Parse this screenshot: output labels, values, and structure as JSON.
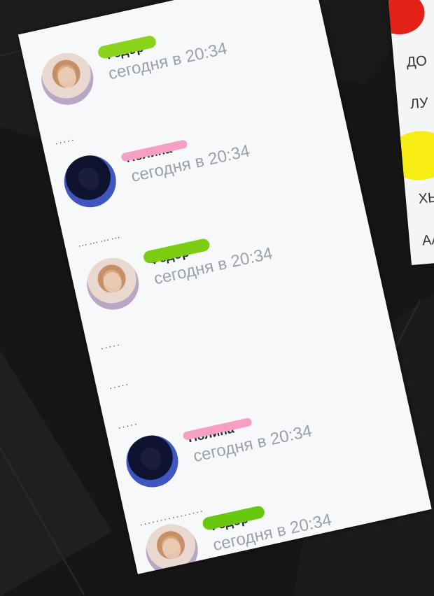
{
  "messages": [
    {
      "name": "Федор",
      "time": "сегодня в 20:34",
      "avatar": "anime",
      "blur_color": "#8bd31a",
      "after_dots": "....."
    },
    {
      "name": "Полина",
      "time": "сегодня в 20:34",
      "avatar": "dark",
      "blur_color": "#f5a0c2",
      "after_dots": "…………"
    },
    {
      "name": "Федор",
      "time": "сегодня в 20:34",
      "avatar": "anime",
      "blur_color": "#7ccd12",
      "after_dots": "....."
    },
    {
      "name": "Полина",
      "time": "сегодня в 20:34",
      "avatar": "dark",
      "blur_color": "#f5a0c2",
      "after_dots": "................"
    },
    {
      "name": "Федор",
      "time": "сегодня в 20:34",
      "avatar": "anime",
      "blur_color": "#68c70f",
      "after_dots": ""
    }
  ],
  "extra_dots": [
    ".....",
    "....."
  ],
  "right_list": [
    "ДО",
    "ЛУ",
    "ХЬ",
    "АА"
  ],
  "colors": {
    "background": "#161616",
    "panel": "#f7f8fa",
    "time": "#9aa1ab",
    "red_blob": "#e32119",
    "yellow_blob": "#f6ee13"
  }
}
